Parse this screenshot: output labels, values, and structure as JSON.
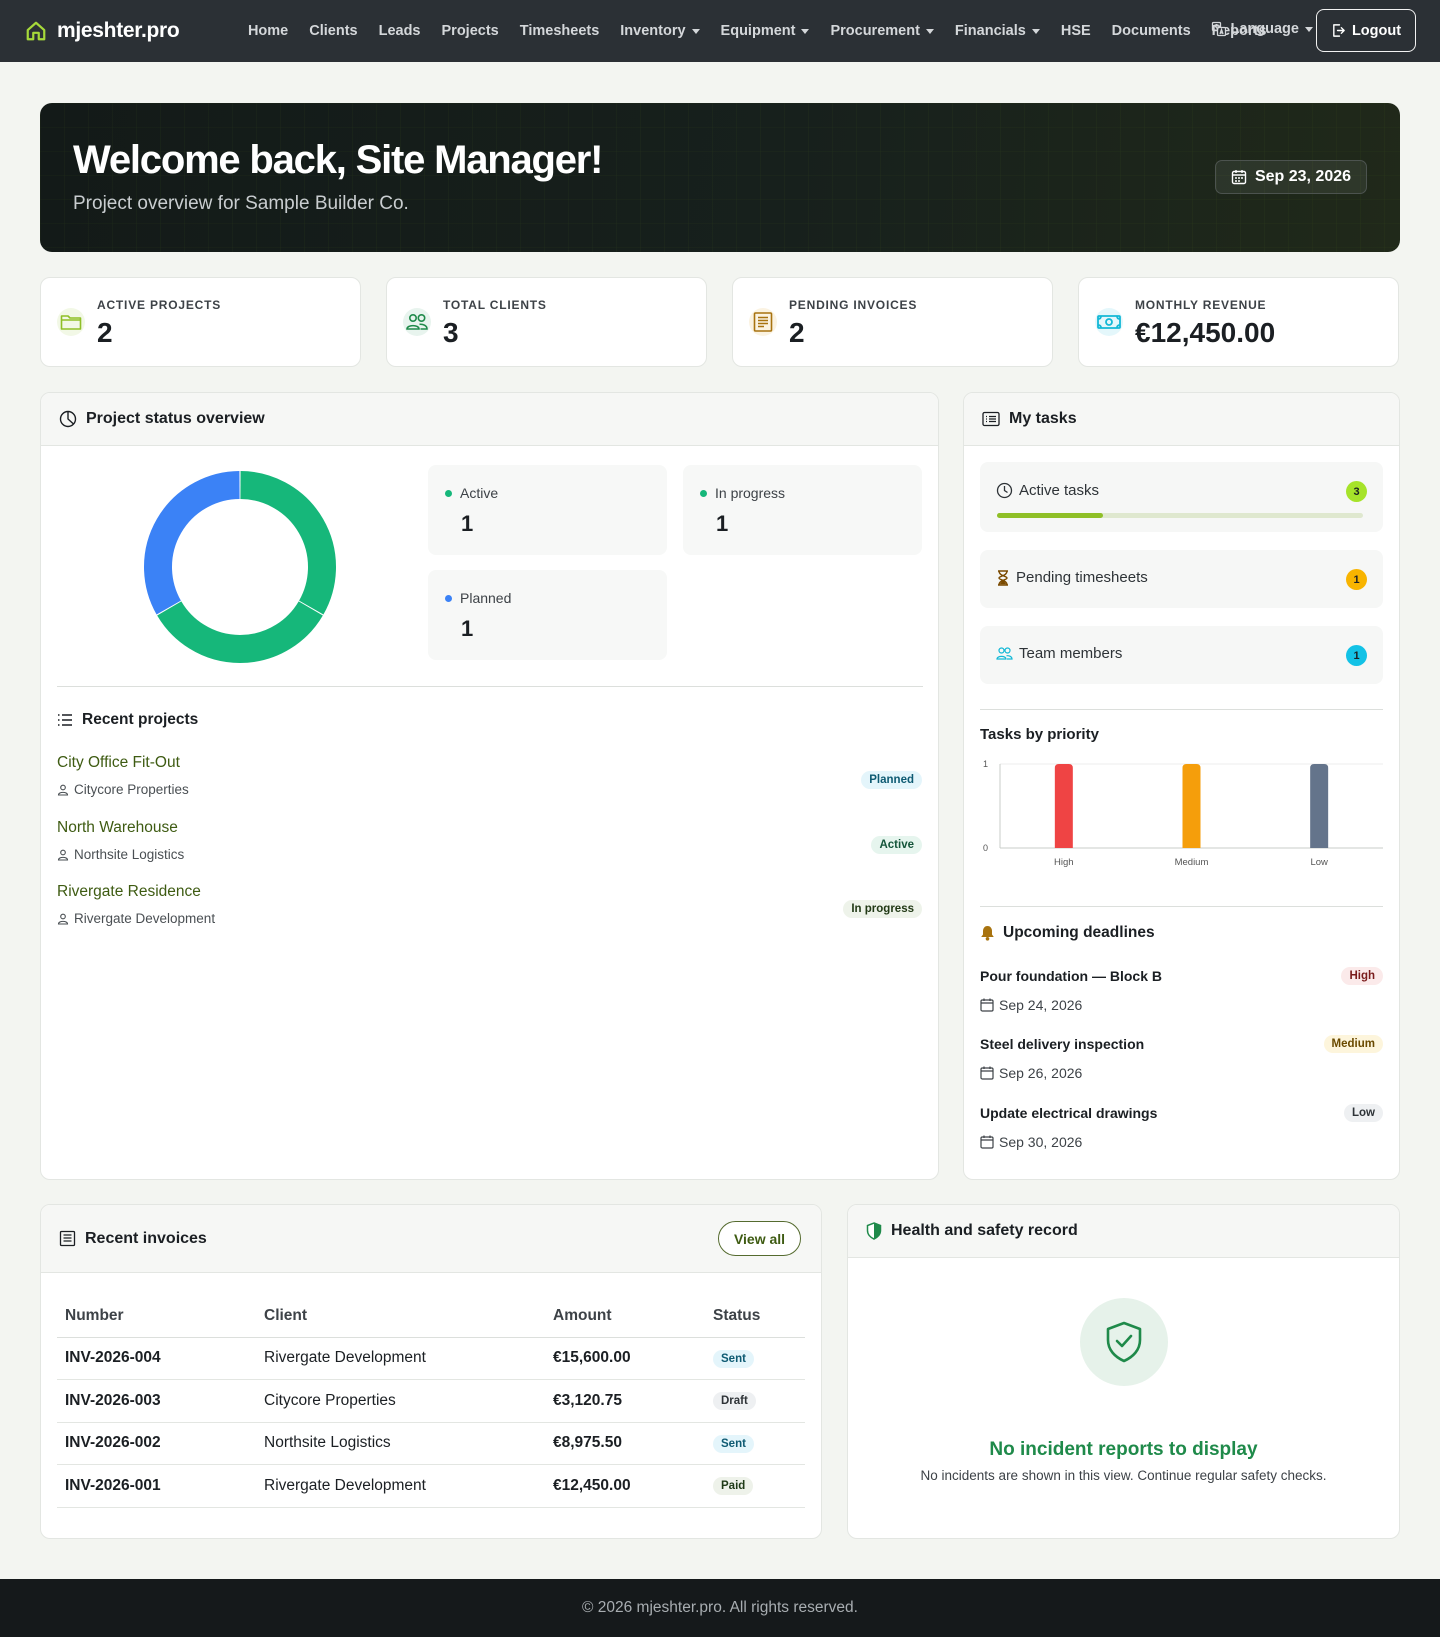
{
  "nav": {
    "brand": "mjeshter.pro",
    "items": [
      {
        "label": "Home",
        "dropdown": false
      },
      {
        "label": "Clients",
        "dropdown": false
      },
      {
        "label": "Leads",
        "dropdown": false
      },
      {
        "label": "Projects",
        "dropdown": false
      },
      {
        "label": "Timesheets",
        "dropdown": false
      },
      {
        "label": "Inventory",
        "dropdown": true
      },
      {
        "label": "Equipment",
        "dropdown": true
      },
      {
        "label": "Procurement",
        "dropdown": true
      },
      {
        "label": "Financials",
        "dropdown": true
      },
      {
        "label": "HSE",
        "dropdown": false
      },
      {
        "label": "Documents",
        "dropdown": false
      },
      {
        "label": "Reports",
        "dropdown": false
      }
    ],
    "language_label": "Language",
    "logout_label": "Logout"
  },
  "hero": {
    "title": "Welcome back, Site Manager!",
    "subtitle": "Project overview for Sample Builder Co.",
    "date": "Sep 23, 2026"
  },
  "stats": [
    {
      "label": "ACTIVE PROJECTS",
      "value": "2",
      "icon": "folder-icon",
      "color": "#8fbf27"
    },
    {
      "label": "TOTAL CLIENTS",
      "value": "3",
      "icon": "users-icon",
      "color": "#1f8a4a"
    },
    {
      "label": "PENDING INVOICES",
      "value": "2",
      "icon": "receipt-icon",
      "color": "#a8730f"
    },
    {
      "label": "MONTHLY REVENUE",
      "value": "€12,450.00",
      "icon": "cash-icon",
      "color": "#13b8d6"
    }
  ],
  "project_status": {
    "title": "Project status overview",
    "items": [
      {
        "label": "Active",
        "count": "1",
        "color": "#16b77a"
      },
      {
        "label": "In progress",
        "count": "1",
        "color": "#16b77a"
      },
      {
        "label": "Planned",
        "count": "1",
        "color": "#3b82f6"
      }
    ],
    "donut": [
      {
        "label": "Active",
        "value": 1,
        "color": "#16b77a"
      },
      {
        "label": "In progress",
        "value": 1,
        "color": "#16b77a"
      },
      {
        "label": "Planned",
        "value": 1,
        "color": "#3b82f6"
      }
    ]
  },
  "recent_projects": {
    "title": "Recent projects",
    "items": [
      {
        "name": "City Office Fit-Out",
        "client": "Citycore Properties",
        "status": "Planned"
      },
      {
        "name": "North Warehouse",
        "client": "Northsite Logistics",
        "status": "Active"
      },
      {
        "name": "Rivergate Residence",
        "client": "Rivergate Development",
        "status": "In progress"
      }
    ]
  },
  "tasks": {
    "title": "My tasks",
    "active_tasks": {
      "label": "Active tasks",
      "count": "3",
      "progress": 0.29
    },
    "pending_timesheets": {
      "label": "Pending timesheets",
      "count": "1"
    },
    "team_members": {
      "label": "Team members",
      "count": "1"
    },
    "priority_title": "Tasks by priority",
    "colors": {
      "active": "#a6e32a",
      "pending": "#f8b400",
      "team": "#13c2e6"
    }
  },
  "chart_data": {
    "type": "bar",
    "title": "Tasks by priority",
    "categories": [
      "High",
      "Medium",
      "Low"
    ],
    "values": [
      1,
      1,
      1
    ],
    "colors": [
      "#ef4444",
      "#f59e0b",
      "#64748b"
    ],
    "ylim": [
      0,
      1
    ],
    "yticks": [
      "0",
      "1"
    ],
    "grid": true
  },
  "deadlines": {
    "title": "Upcoming deadlines",
    "items": [
      {
        "title": "Pour foundation — Block B",
        "date": "Sep 24, 2026",
        "priority": "High"
      },
      {
        "title": "Steel delivery inspection",
        "date": "Sep 26, 2026",
        "priority": "Medium"
      },
      {
        "title": "Update electrical drawings",
        "date": "Sep 30, 2026",
        "priority": "Low"
      }
    ]
  },
  "invoices": {
    "title": "Recent invoices",
    "view_all": "View all",
    "columns": [
      "Number",
      "Client",
      "Amount",
      "Status"
    ],
    "rows": [
      {
        "number": "INV-2026-004",
        "client": "Rivergate Development",
        "amount": "€15,600.00",
        "status": "Sent"
      },
      {
        "number": "INV-2026-003",
        "client": "Citycore Properties",
        "amount": "€3,120.75",
        "status": "Draft"
      },
      {
        "number": "INV-2026-002",
        "client": "Northsite Logistics",
        "amount": "€8,975.50",
        "status": "Sent"
      },
      {
        "number": "INV-2026-001",
        "client": "Rivergate Development",
        "amount": "€12,450.00",
        "status": "Paid"
      }
    ]
  },
  "hse": {
    "title": "Health and safety record",
    "empty_title": "No incident reports to display",
    "empty_text": "No incidents are shown in this view. Continue regular safety checks."
  },
  "footer": {
    "text": "© 2026 mjeshter.pro. All rights reserved."
  }
}
